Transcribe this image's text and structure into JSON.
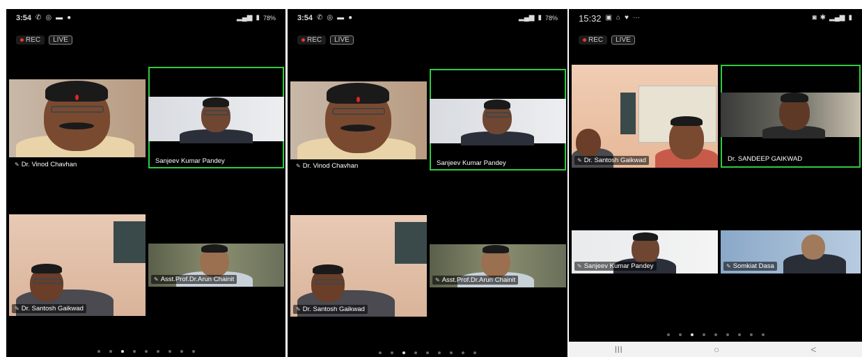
{
  "screens": [
    {
      "status_time": "3:54",
      "status_right": "78%",
      "rec": "REC",
      "live": "LIVE",
      "participants": [
        "Dr. Vinod Chavhan",
        "Sanjeev Kumar Pandey",
        "Dr. Santosh Gaikwad",
        "Asst.Prof.Dr.Arun Chainit"
      ],
      "page_dots": 9,
      "active_dot": 2
    },
    {
      "status_time": "3:54",
      "status_right": "78%",
      "rec": "REC",
      "live": "LIVE",
      "participants": [
        "Dr. Vinod Chavhan",
        "Sanjeev Kumar Pandey",
        "Dr. Santosh Gaikwad",
        "Asst.Prof.Dr.Arun Chainit"
      ],
      "page_dots": 9,
      "active_dot": 2
    },
    {
      "status_time": "15:32",
      "rec": "REC",
      "live": "LIVE",
      "participants": [
        "Dr. Santosh Gaikwad",
        "Dr. SANDEEP GAIKWAD",
        "Sanjeev Kumar Pandey",
        "Somkiat Dasa"
      ],
      "page_dots": 9,
      "active_dot": 2,
      "nav": {
        "recents": "III",
        "home": "○",
        "back": "<"
      }
    }
  ],
  "colors": {
    "active_border": "#2ecc40",
    "rec_dot": "#e53935"
  }
}
